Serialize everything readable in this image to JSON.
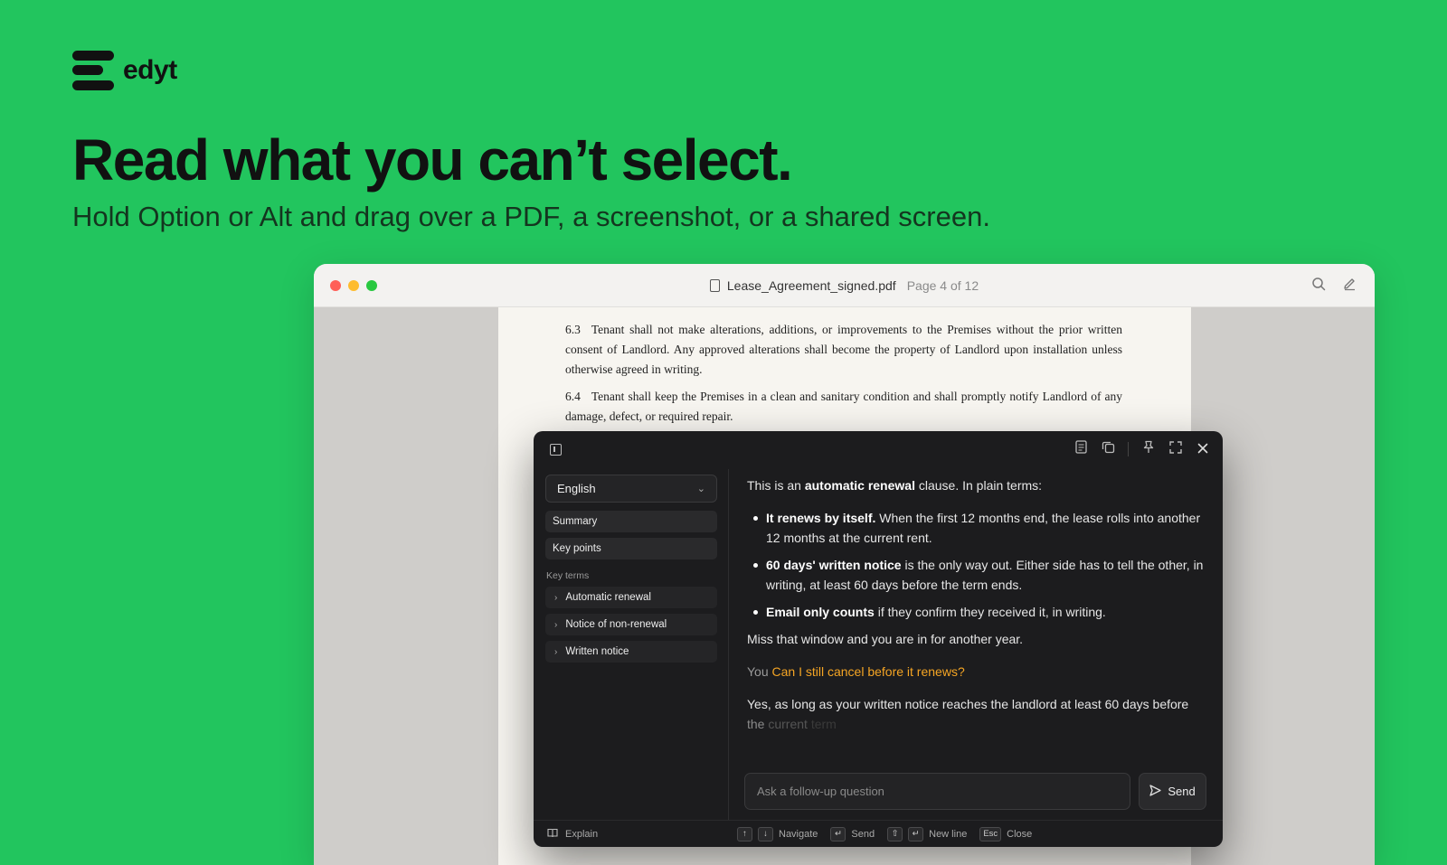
{
  "brand": {
    "name": "edyt"
  },
  "hero": {
    "headline": "Read what you can’t select.",
    "subhead": "Hold Option or Alt and drag over a PDF, a screenshot, or a shared screen."
  },
  "window": {
    "file_name": "Lease_Agreement_signed.pdf",
    "page_info": "Page 4 of 12",
    "icons": [
      "file-icon",
      "search-icon",
      "pen-icon"
    ]
  },
  "document": {
    "clauses": [
      {
        "num": "6.3",
        "text": "Tenant shall not make alterations, additions, or improvements to the Premises without the prior written consent of Landlord. Any approved alterations shall become the property of Landlord upon installation unless otherwise agreed in writing."
      },
      {
        "num": "6.4",
        "text": "Tenant shall keep the Premises in a clean and sanitary condition and shall promptly notify Landlord of any damage, defect, or required repair."
      }
    ]
  },
  "panel": {
    "language": "English",
    "summary_label": "Summary",
    "key_points_label": "Key points",
    "key_terms_label": "Key terms",
    "key_terms": [
      "Automatic renewal",
      "Notice of non-renewal",
      "Written notice"
    ],
    "intro_prefix": "This is an ",
    "intro_bold": "automatic renewal",
    "intro_suffix": " clause. In plain terms:",
    "bullets": [
      {
        "bold": "It renews by itself.",
        "text": " When the first 12 months end, the lease rolls into another 12 months at the current rent."
      },
      {
        "bold": "60 days' written notice",
        "text": " is the only way out. Either side has to tell the other, in writing, at least 60 days before the term ends."
      },
      {
        "bold": "Email only counts",
        "text": " if they confirm they received it, in writing."
      }
    ],
    "closing": "Miss that window and you are in for another year.",
    "you_label": "You",
    "question": "Can I still cancel before it renews?",
    "answer_main": "Yes, as long as your written notice reaches the landlord at least 60 days before ",
    "answer_fade1": "the",
    "answer_fade2": "current",
    "answer_fade3": "term",
    "input_placeholder": "Ask a follow-up question",
    "send_label": "Send",
    "footer": {
      "explain_label": "Explain",
      "up_key": "↑",
      "down_key": "↓",
      "navigate_label": "Navigate",
      "enter_key": "↵",
      "send_label": "Send",
      "shift_key": "⇧",
      "enter_key2": "↵",
      "newline_label": "New line",
      "esc_key": "Esc",
      "close_label": "Close"
    }
  }
}
